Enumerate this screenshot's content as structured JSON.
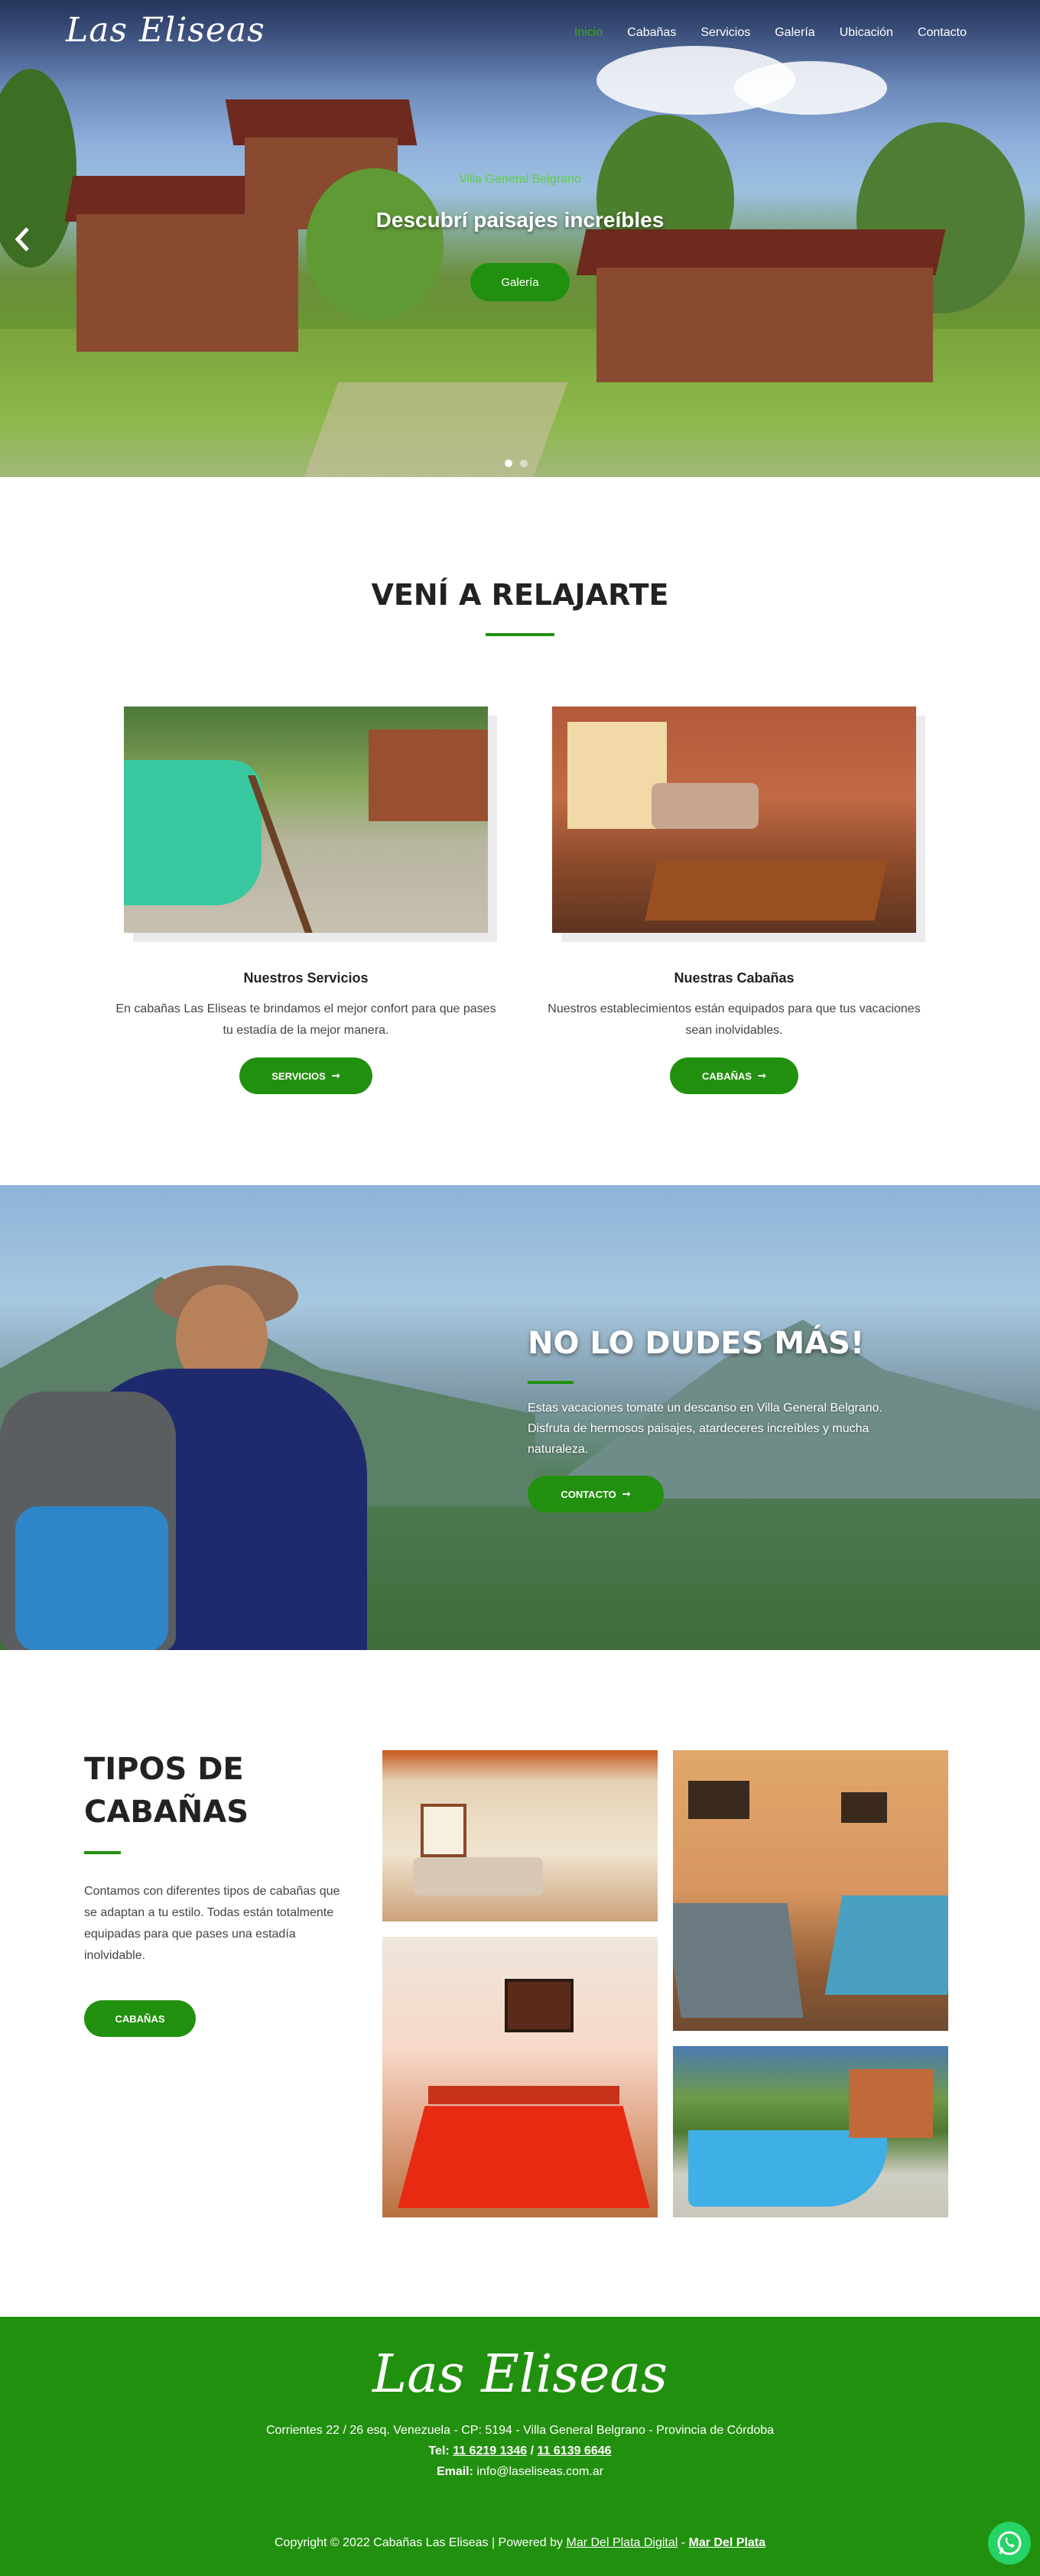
{
  "brand": {
    "logo": "Las Eliseas",
    "accent": "#22900f"
  },
  "nav": {
    "items": [
      {
        "label": "Inicio",
        "active": true
      },
      {
        "label": "Cabañas"
      },
      {
        "label": "Servicios"
      },
      {
        "label": "Galería"
      },
      {
        "label": "Ubicación"
      },
      {
        "label": "Contacto"
      }
    ]
  },
  "hero": {
    "subtitle": "Villa General Belgrano",
    "title": "Descubrí paisajes increíbles",
    "button": "Galería",
    "prev_icon": "chevron-left-icon"
  },
  "relax": {
    "title": "VENÍ A RELAJARTE",
    "cards": [
      {
        "title": "Nuestros Servicios",
        "text": "En cabañas Las Eliseas te brindamos el mejor confort para que pases tu estadía de la mejor manera.",
        "button": "SERVICIOS",
        "icon": "arrow-right-icon"
      },
      {
        "title": "Nuestras Cabañas",
        "text": "Nuestros establecimientos están equipados para que tus vacaciones sean inolvidables.",
        "button": "CABAÑAS",
        "icon": "arrow-right-icon"
      }
    ]
  },
  "banner": {
    "title": "NO LO DUDES MÁS!",
    "text": "Estas vacaciones tomate un descanso en Villa General Belgrano. Disfruta de hermosos paisajes, atardeceres increíbles y mucha naturaleza.",
    "button": "CONTACTO"
  },
  "tipos": {
    "title_line1": "TIPOS DE",
    "title_line2": "CABAÑAS",
    "text": "Contamos con diferentes tipos de cabañas que se adaptan a tu estilo. Todas están totalmente equipadas para que pases una estadía inolvidable.",
    "button": "CABAÑAS"
  },
  "footer": {
    "logo": "Las Eliseas",
    "address": "Corrientes 22 / 26 esq. Venezuela - CP: 5194 - Villa General Belgrano - Provincia de Córdoba",
    "tel_label": "Tel:",
    "tel1": "11 6219 1346",
    "tel_sep": " / ",
    "tel2": "11 6139 6646",
    "email_label": "Email:",
    "email": "info@laseliseas.com.ar",
    "copyright": "Copyright © 2022 Cabañas Las Eliseas | Powered by",
    "powered_by": "Mar Del Plata Digital",
    "sep": " - ",
    "powered_city": "Mar Del Plata",
    "whatsapp_icon": "whatsapp-icon"
  }
}
